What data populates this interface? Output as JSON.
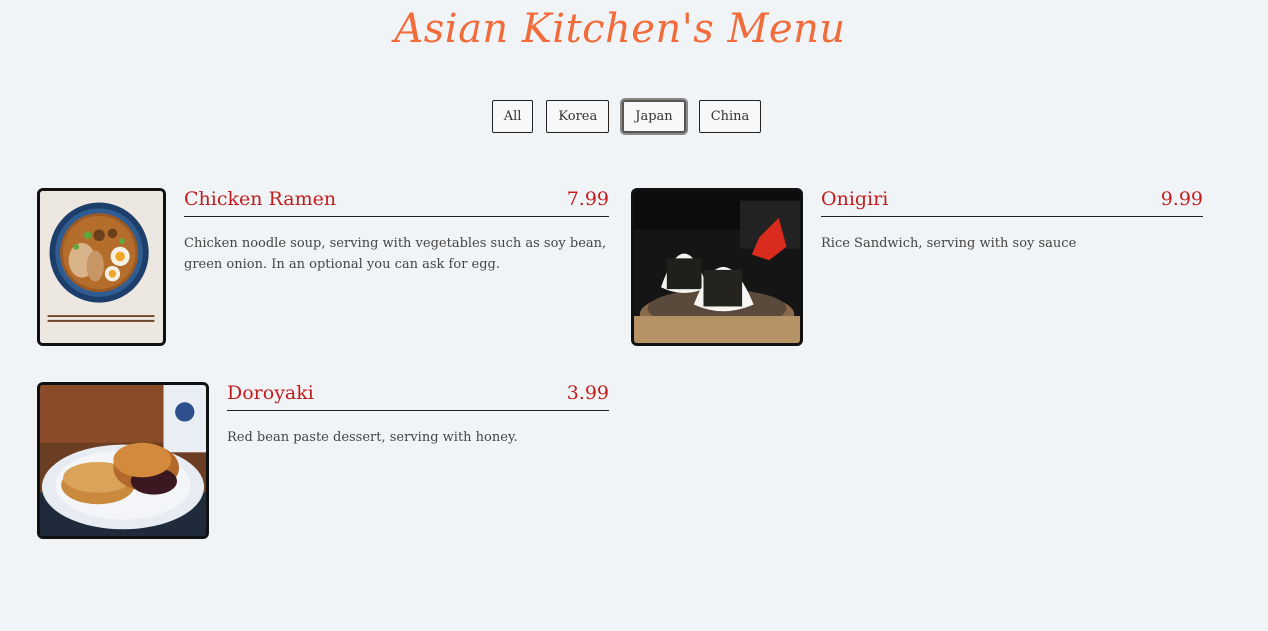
{
  "header": {
    "title": "Asian Kitchen's Menu"
  },
  "filters": [
    {
      "label": "All",
      "active": false
    },
    {
      "label": "Korea",
      "active": false
    },
    {
      "label": "Japan",
      "active": true
    },
    {
      "label": "China",
      "active": false
    }
  ],
  "menu": {
    "items": [
      {
        "name": "Chicken Ramen",
        "price": "7.99",
        "desc": "Chicken noodle soup, serving with vegetables such as soy bean, green onion. In an optional you can ask for egg.",
        "image": "ramen-bowl-image"
      },
      {
        "name": "Onigiri",
        "price": "9.99",
        "desc": "Rice Sandwich, serving with soy sauce",
        "image": "onigiri-image"
      },
      {
        "name": "Doroyaki",
        "price": "3.99",
        "desc": "Red bean paste dessert, serving with honey.",
        "image": "dorayaki-image"
      }
    ]
  },
  "colors": {
    "title": "#f26b3a",
    "item_text": "#c21c1c",
    "background": "#f1f4f7"
  }
}
